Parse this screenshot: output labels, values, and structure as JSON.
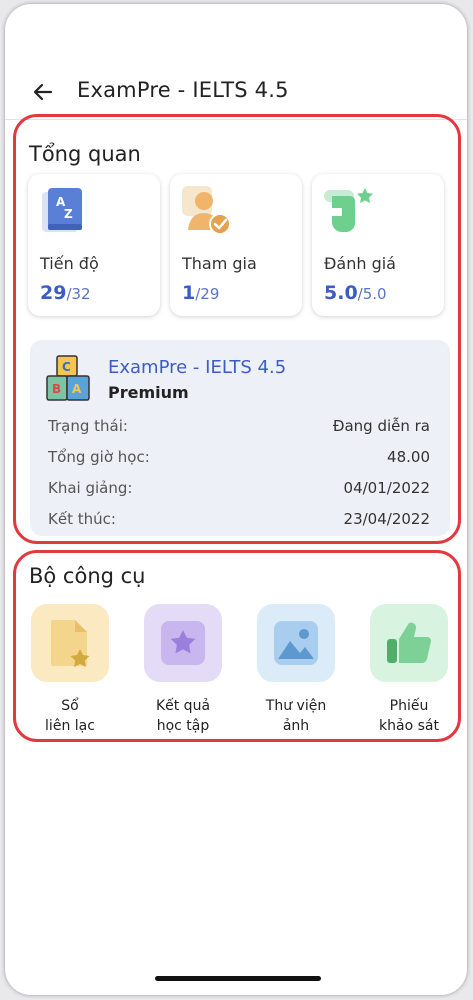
{
  "header": {
    "title": "ExamPre - IELTS 4.5"
  },
  "overview": {
    "title": "Tổng quan",
    "stats": [
      {
        "label": "Tiến độ",
        "value": "29",
        "total": "/32",
        "icon": "az-book-icon"
      },
      {
        "label": "Tham gia",
        "value": "1",
        "total": "/29",
        "icon": "user-check-icon"
      },
      {
        "label": "Đánh giá",
        "value": "5.0",
        "total": "/5.0",
        "icon": "hand-star-icon"
      }
    ],
    "course": {
      "title": "ExamPre - IELTS 4.5",
      "plan": "Premium",
      "rows": [
        {
          "label": "Trạng thái:",
          "value": "Đang diễn ra"
        },
        {
          "label": "Tổng giờ học:",
          "value": "48.00"
        },
        {
          "label": "Khai giảng:",
          "value": "04/01/2022"
        },
        {
          "label": "Kết thúc:",
          "value": "23/04/2022"
        }
      ]
    }
  },
  "tools": {
    "title": "Bộ công cụ",
    "items": [
      {
        "label": "Sổ\nliên lạc",
        "icon": "notebook-star-icon",
        "color": "#fbe9c2"
      },
      {
        "label": "Kết quả\nhọc tập",
        "icon": "star-badge-icon",
        "color": "#e4dcf7"
      },
      {
        "label": "Thư viện\nảnh",
        "icon": "image-gallery-icon",
        "color": "#dcebf8"
      },
      {
        "label": "Phiếu\nkhảo sát",
        "icon": "thumbs-up-icon",
        "color": "#d8f3df"
      }
    ]
  },
  "colors": {
    "accent": "#3b5cc4",
    "highlight_border": "#e2383f"
  }
}
